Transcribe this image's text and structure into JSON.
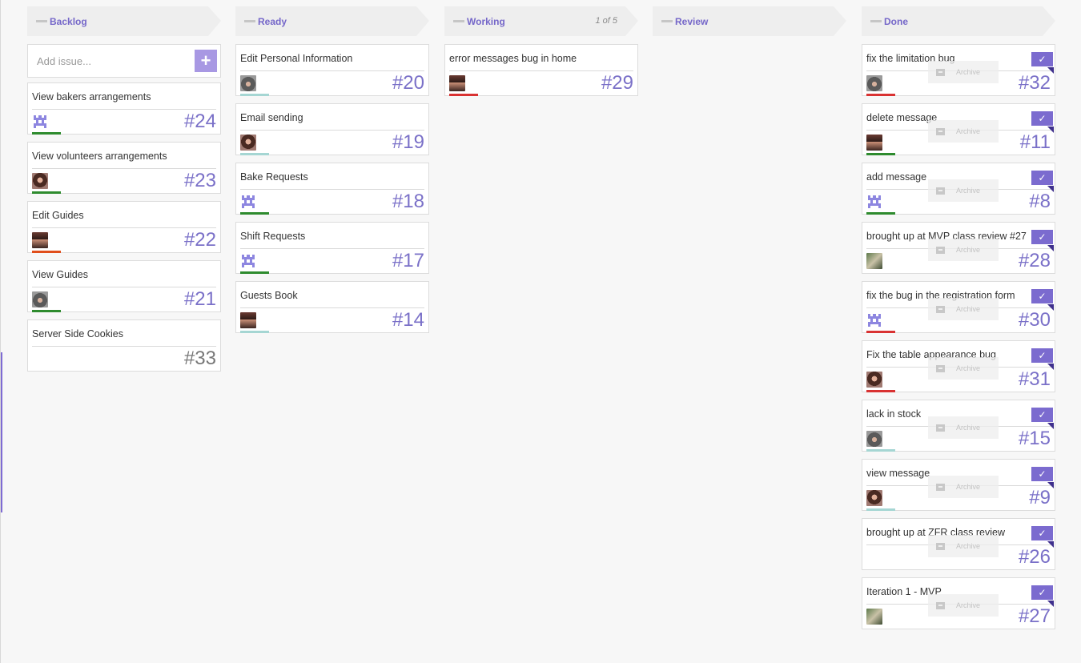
{
  "colors": {
    "accent": "#7b6bcf",
    "green": "#2e8b2e",
    "red": "#d93232",
    "orange": "#e04e1b",
    "teal": "#a5d6d3"
  },
  "columns": [
    {
      "title": "Backlog",
      "count": "",
      "add": {
        "placeholder": "Add issue...",
        "button": "+"
      },
      "cards": [
        {
          "title": "View bakers arrangements",
          "num": "#24",
          "avatar": "pixel",
          "label": "green"
        },
        {
          "title": "View volunteers arrangements",
          "num": "#23",
          "avatar": "woman2",
          "label": "green"
        },
        {
          "title": "Edit Guides",
          "num": "#22",
          "avatar": "woman",
          "label": "orange"
        },
        {
          "title": "View Guides",
          "num": "#21",
          "avatar": "hood",
          "label": "green"
        },
        {
          "title": "Server Side Cookies",
          "num": "#33",
          "avatar": "",
          "label": ""
        }
      ]
    },
    {
      "title": "Ready",
      "count": "",
      "cards": [
        {
          "title": "Edit Personal Information",
          "num": "#20",
          "avatar": "hood",
          "label": "teal"
        },
        {
          "title": "Email sending",
          "num": "#19",
          "avatar": "woman2",
          "label": "teal"
        },
        {
          "title": "Bake Requests",
          "num": "#18",
          "avatar": "pixel",
          "label": "green"
        },
        {
          "title": "Shift Requests",
          "num": "#17",
          "avatar": "pixel",
          "label": "green"
        },
        {
          "title": "Guests Book",
          "num": "#14",
          "avatar": "woman",
          "label": "teal"
        }
      ]
    },
    {
      "title": "Working",
      "count": "1 of 5",
      "cards": [
        {
          "title": "error messages bug in home",
          "num": "#29",
          "avatar": "woman",
          "label": "red"
        }
      ]
    },
    {
      "title": "Review",
      "count": "",
      "cards": []
    },
    {
      "title": "Done",
      "count": "",
      "archive_label": "Archive",
      "check_icon": "✓",
      "cards": [
        {
          "title": "fix the limitation bug",
          "num": "#32",
          "avatar": "hood",
          "label": "red"
        },
        {
          "title": "delete message",
          "num": "#11",
          "avatar": "woman",
          "label": "green"
        },
        {
          "title": "add message",
          "num": "#8",
          "avatar": "pixel",
          "label": "green"
        },
        {
          "title": "brought up at MVP class review #27",
          "num": "#28",
          "avatar": "photo",
          "label": ""
        },
        {
          "title": "fix the bug in the registration form",
          "num": "#30",
          "avatar": "pixel",
          "label": "red"
        },
        {
          "title": "Fix the table appearance bug",
          "num": "#31",
          "avatar": "woman2",
          "label": "red"
        },
        {
          "title": "lack in stock",
          "num": "#15",
          "avatar": "hood",
          "label": "teal"
        },
        {
          "title": "view message",
          "num": "#9",
          "avatar": "woman2",
          "label": "teal"
        },
        {
          "title": "brought up at ZFR class review",
          "num": "#26",
          "avatar": "",
          "label": ""
        },
        {
          "title": "Iteration 1 - MVP",
          "num": "#27",
          "avatar": "photo",
          "label": ""
        }
      ]
    }
  ]
}
